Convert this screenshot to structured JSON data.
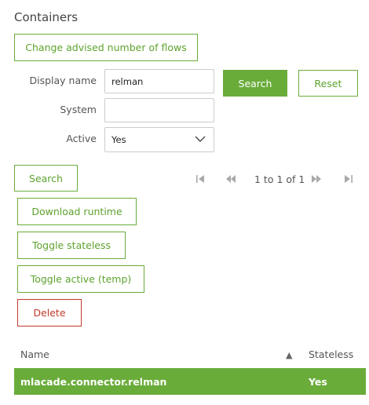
{
  "page": {
    "title": "Containers"
  },
  "toolbar": {
    "change_flows_label": "Change advised number of flows"
  },
  "filters": {
    "display_name": {
      "label": "Display name",
      "value": "relman"
    },
    "system": {
      "label": "System",
      "value": ""
    },
    "active": {
      "label": "Active",
      "value": "Yes"
    },
    "search_label": "Search",
    "reset_label": "Reset"
  },
  "actions": {
    "search_label": "Search",
    "download_runtime_label": "Download runtime",
    "toggle_stateless_label": "Toggle stateless",
    "toggle_active_label": "Toggle active (temp)",
    "delete_label": "Delete"
  },
  "pager": {
    "text": "1 to 1 of 1"
  },
  "table": {
    "columns": {
      "name": "Name",
      "stateless": "Stateless"
    },
    "sort_indicator": "▲",
    "rows": [
      {
        "name": "mlacade.connector.relman",
        "stateless": "Yes",
        "selected": true
      }
    ]
  },
  "colors": {
    "accent": "#6aac3a",
    "danger": "#c0392b",
    "border": "#cccccc"
  }
}
